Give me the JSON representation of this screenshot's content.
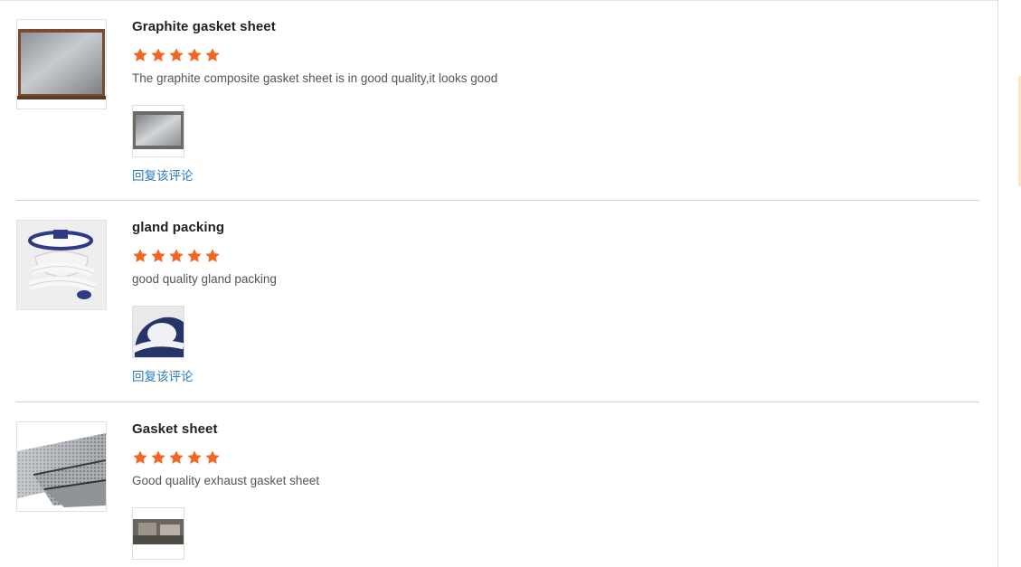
{
  "reviews": [
    {
      "title": "Graphite gasket sheet",
      "rating": 5,
      "max_rating": 5,
      "comment": "The graphite composite gasket sheet is in good quality,it looks good",
      "reply_label": "回复该评论"
    },
    {
      "title": "gland packing",
      "rating": 5,
      "max_rating": 5,
      "comment": "good quality gland packing",
      "reply_label": "回复该评论"
    },
    {
      "title": "Gasket sheet",
      "rating": 5,
      "max_rating": 5,
      "comment": "Good quality exhaust gasket sheet"
    }
  ],
  "colors": {
    "star": "#f26522",
    "link": "#2a7ab8",
    "divider": "#cfcfcf"
  }
}
